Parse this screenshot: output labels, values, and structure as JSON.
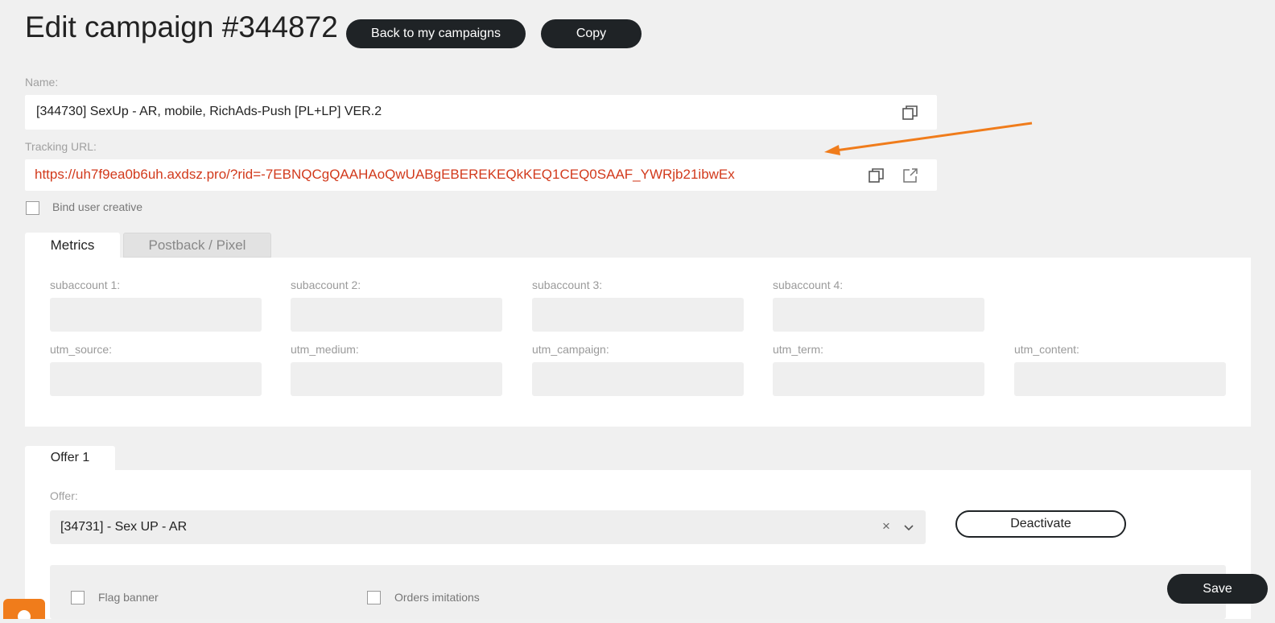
{
  "header": {
    "title": "Edit campaign #344872",
    "back_label": "Back to my campaigns",
    "copy_label": "Copy"
  },
  "name_field": {
    "label": "Name:",
    "value": "[344730] SexUp - AR, mobile, RichAds-Push [PL+LP] VER.2"
  },
  "tracking": {
    "label": "Tracking URL:",
    "url": "https://uh7f9ea0b6uh.axdsz.pro/?rid=-7EBNQCgQAAHAoQwUABgEBEREKEQkKEQ1CEQ0SAAF_YWRjb21ibwEx"
  },
  "bind_creative": {
    "label": "Bind user creative",
    "checked": false
  },
  "tabs": [
    {
      "label": "Metrics",
      "active": true
    },
    {
      "label": "Postback / Pixel",
      "active": false
    }
  ],
  "metrics": {
    "row1": [
      {
        "label": "subaccount 1:",
        "value": ""
      },
      {
        "label": "subaccount 2:",
        "value": ""
      },
      {
        "label": "subaccount 3:",
        "value": ""
      },
      {
        "label": "subaccount 4:",
        "value": ""
      }
    ],
    "row2": [
      {
        "label": "utm_source:",
        "value": ""
      },
      {
        "label": "utm_medium:",
        "value": ""
      },
      {
        "label": "utm_campaign:",
        "value": ""
      },
      {
        "label": "utm_term:",
        "value": ""
      },
      {
        "label": "utm_content:",
        "value": ""
      }
    ]
  },
  "offer_tab": {
    "label": "Offer 1"
  },
  "offer": {
    "label": "Offer:",
    "value": "[34731] - Sex UP - AR",
    "clear": "×",
    "deactivate_label": "Deactivate"
  },
  "options": {
    "flag_banner": "Flag banner",
    "orders_imitations": "Orders imitations"
  },
  "save_label": "Save",
  "colors": {
    "accent_orange": "#f07c1b",
    "url_red": "#d23a1c",
    "dark_button": "#1f2326"
  }
}
